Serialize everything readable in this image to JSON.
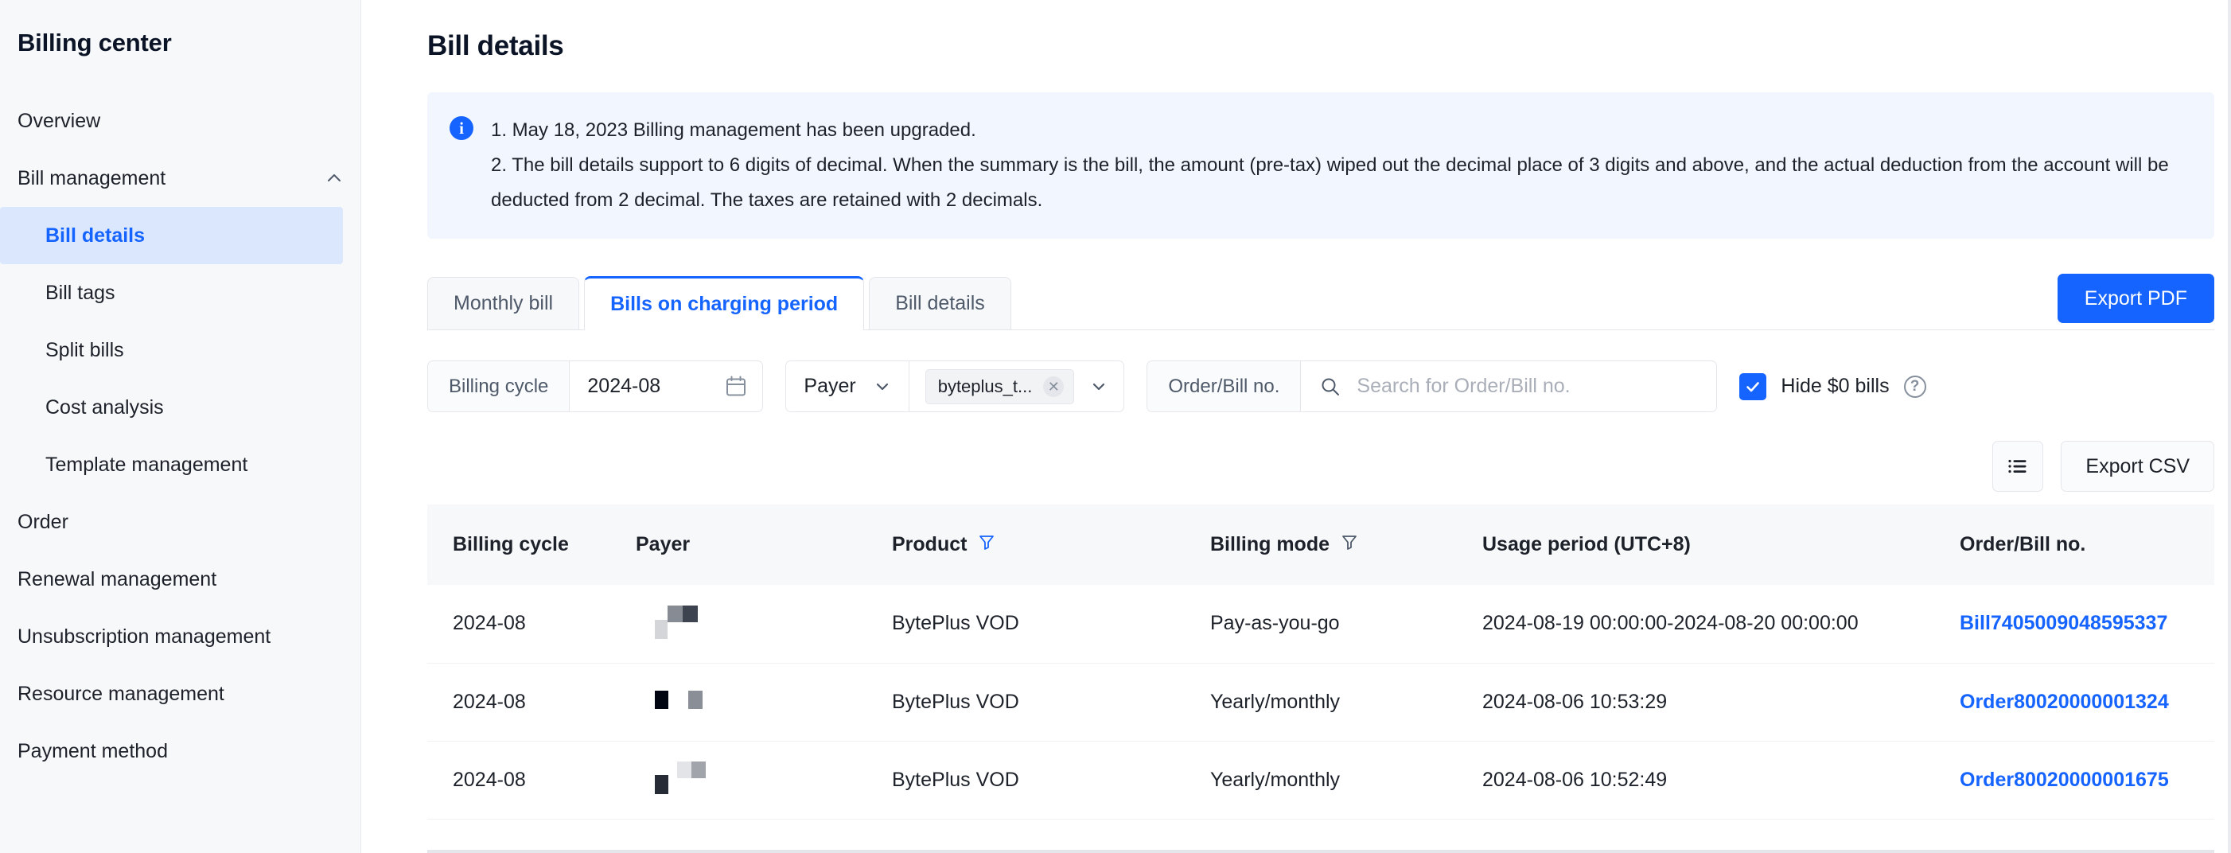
{
  "sidebar": {
    "title": "Billing center",
    "items": [
      {
        "label": "Overview",
        "level": "top",
        "active": false
      },
      {
        "label": "Bill management",
        "level": "top",
        "active": false,
        "expanded": true,
        "icon": "chevron-up-icon"
      },
      {
        "label": "Bill details",
        "level": "sub",
        "active": true
      },
      {
        "label": "Bill tags",
        "level": "sub",
        "active": false
      },
      {
        "label": "Split bills",
        "level": "sub",
        "active": false
      },
      {
        "label": "Cost analysis",
        "level": "sub",
        "active": false
      },
      {
        "label": "Template management",
        "level": "sub",
        "active": false
      },
      {
        "label": "Order",
        "level": "top",
        "active": false
      },
      {
        "label": "Renewal management",
        "level": "top",
        "active": false
      },
      {
        "label": "Unsubscription management",
        "level": "top",
        "active": false
      },
      {
        "label": "Resource management",
        "level": "top",
        "active": false
      },
      {
        "label": "Payment method",
        "level": "top",
        "active": false
      }
    ]
  },
  "page": {
    "title": "Bill details"
  },
  "banner": {
    "icon": "info-icon",
    "line1": "1. May 18, 2023 Billing management has been upgraded.",
    "line2": "2. The bill details support to 6 digits of decimal. When the summary is the bill, the amount (pre-tax) wiped out the decimal place of 3 digits and above, and the actual deduction from the account will be deducted from 2 decimal. The taxes are retained with 2 decimals."
  },
  "tabs": [
    {
      "label": "Monthly bill",
      "active": false
    },
    {
      "label": "Bills on charging period",
      "active": true
    },
    {
      "label": "Bill details",
      "active": false
    }
  ],
  "actions": {
    "export_pdf": "Export PDF",
    "export_csv": "Export CSV",
    "column_settings_icon": "list-settings-icon"
  },
  "filters": {
    "billing_cycle": {
      "label": "Billing cycle",
      "value": "2024-08",
      "icon": "calendar-icon"
    },
    "payer": {
      "label": "Payer",
      "tag": "byteplus_t...",
      "tag_remove_icon": "close-icon",
      "caret_icon": "chevron-down-icon"
    },
    "order_search": {
      "label": "Order/Bill no.",
      "placeholder": "Search for Order/Bill no.",
      "value": "",
      "icon": "search-icon"
    },
    "hide_zero": {
      "label": "Hide $0 bills",
      "checked": true,
      "help_icon": "question-circle-icon"
    }
  },
  "table": {
    "columns": [
      {
        "key": "billing_cycle",
        "label": "Billing cycle",
        "filter": false
      },
      {
        "key": "payer",
        "label": "Payer",
        "filter": false
      },
      {
        "key": "product",
        "label": "Product",
        "filter": true,
        "filter_active": true,
        "filter_icon": "funnel-icon"
      },
      {
        "key": "billing_mode",
        "label": "Billing mode",
        "filter": true,
        "filter_active": false,
        "filter_icon": "funnel-icon"
      },
      {
        "key": "usage_period",
        "label": "Usage period (UTC+8)",
        "filter": false
      },
      {
        "key": "order_bill_no",
        "label": "Order/Bill no.",
        "filter": false
      }
    ],
    "rows": [
      {
        "billing_cycle": "2024-08",
        "payer": "",
        "payer_redacted": true,
        "product": "BytePlus VOD",
        "billing_mode": "Pay-as-you-go",
        "usage_period": "2024-08-19 00:00:00-2024-08-20 00:00:00",
        "order_bill_no": "Bill7405009048595337"
      },
      {
        "billing_cycle": "2024-08",
        "payer": "",
        "payer_redacted": true,
        "product": "BytePlus VOD",
        "billing_mode": "Yearly/monthly",
        "usage_period": "2024-08-06 10:53:29",
        "order_bill_no": "Order80020000001324"
      },
      {
        "billing_cycle": "2024-08",
        "payer": "",
        "payer_redacted": true,
        "product": "BytePlus VOD",
        "billing_mode": "Yearly/monthly",
        "usage_period": "2024-08-06 10:52:49",
        "order_bill_no": "Order80020000001675"
      }
    ]
  },
  "colors": {
    "accent": "#1664ff",
    "sidebar_bg": "#f7f8fa",
    "active_nav_bg": "#dbe7fd",
    "banner_bg": "#f2f6ff",
    "border": "#e5e6eb",
    "text": "#1d2129"
  }
}
